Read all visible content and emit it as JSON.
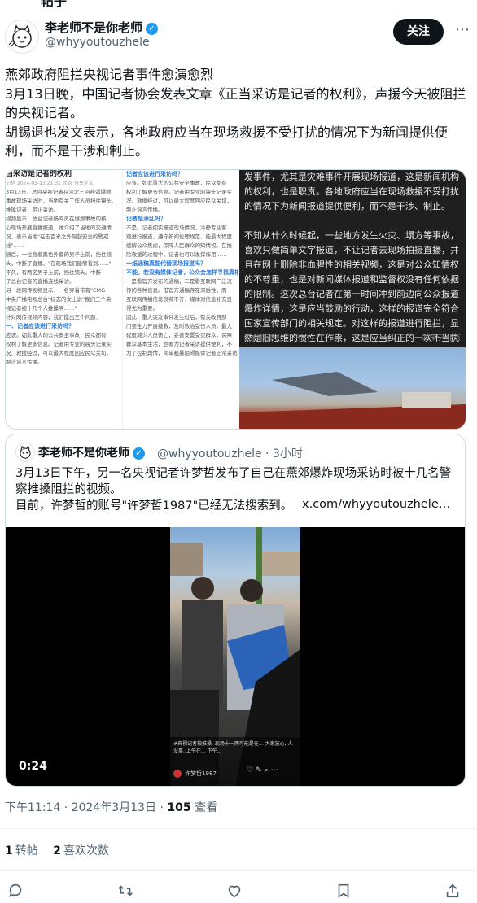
{
  "topcut_text": "帖子",
  "author": {
    "name": "李老师不是你老师",
    "handle": "@whyyoutouzhele"
  },
  "follow_label": "关注",
  "more_label": "⋯",
  "tweet": {
    "lines": [
      "燕郊政府阻拦央视记者事件愈演愈烈",
      "3月13日晚，中国记者协会发表文章《正当采访是记者的权利》，声援今天被阻拦的央视记者。",
      "胡锡退也发文表示，各地政府应当在现场救援不受打扰的情况下为新闻提供便利，而不是干涉和制止。"
    ]
  },
  "media": {
    "doc1": {
      "title": "当采访是记者的权利",
      "meta": "记协   2024-03-13 21:31   北京   分享全文",
      "paras": [
        "3月13日，总台央视记者在河北三河燕郊爆燃",
        "事故现场采访时，当地有关工作人员挡住镜头、",
        "推搡记者，阻止采访。",
        "视频显示，总台记者杨海灵在爆燃事故的核",
        "心现场开展直播报道，她介绍了当地的交通情",
        "况，表示当地\"在五百米之外架起安全的警戒",
        "线\"……",
        "随后，一位身着黑色外套的男子上前，挡住镜",
        "头，中断了直播。\"在现场我们能够看到……\"",
        "不久，有两名男子上前，挡住镜头，中断",
        "了总台记者的直播连线采访。",
        "另一段网传视频显示，一名穿着带有\"CMG",
        "中央广播电视总台\"标志的女士说\"我们三个央",
        "视记者被十几个人推搡啊……\"",
        "针对网传视频内容，我们提出三个问题：",
        "一、记者应该进行采访吗？",
        "应该。如此重大的公共安全事故，民众都有",
        "权利了解更多信息。记者用专业的镜头记录实",
        "况、救援经过，可以最大程度回应民众关切，",
        "制止谣言传播。"
      ]
    },
    "doc2": {
      "paras": [
        "记者应该进行采访吗？",
        "应该。如此重大的公共安全事故，民众都有",
        "权利了解更多信息。记者用专业的镜头记录实",
        "况、救援经过，可以最大程度回应民众关切，",
        "制止谣言传播。",
        "记者是添乱吗？",
        "不是。记者如实报道现场情况，冷静专业客",
        "观进行报道，遵守新闻伦理规范，能最大程度",
        "缓解公众焦虑，保障人民群众的知情权。在抢",
        "险救援的过程中，记者也可以发挥作用……",
        "一纸通稿真能代替现场报道吗？",
        "不能。若没有媒体记者，公众会怎样寻找真相？",
        "一是看官方发布的通稿，二是看互联网广泛流",
        "传的各种信息。但官方通稿存在滞后性，而",
        "互联网传播信息良莠不齐，媒体对信息补充显",
        "得尤为重要。",
        "因此，重大突发事件发生过后，有关政府部",
        "门要全力开展搜救，及时救治受伤人员，最大",
        "程度减少人员伤亡，妥善安置受灾群众，保障",
        "群众基本生活，也要为记者采访提供便利，不",
        "为了控制舆情，简单粗暴阻碍媒体记者正常采访。"
      ]
    },
    "doc3": {
      "text": "发事件，尤其是灾难事件开展现场报道，这是新闻机构的权利，也是职责。各地政府应当在现场救援不受打扰的情况下为新闻报道提供便利，而不是干涉、制止。\n\n不知从什么时候起，一些地方发生火灾、塌方等事故，喜欢只做简单文字报道，不让记者去现场拍摄直播，并且在网上删除非血腥性的相关视频，这是对公众知情权的不尊重，也是对新闻媒体报道和监督权没有任何依据的限制。这次总台记者在第一时间冲到前边向公众报道爆炸详情，这是应当鼓励的行动，这样的报道完全符合国家宣传部门的相关规定。对这样的报道进行阻拦，显然是旧思维的惯性在作祟，这是应当纠正的一次不当执法。",
      "translate": "查看翻译",
      "location": "发布于 北京"
    }
  },
  "quote": {
    "name": "李老师不是你老师",
    "handle": "@whyyoutouzhele · 3小时",
    "lines": [
      "3月13日下午，另一名央视记者许梦哲发布了自己在燕郊爆炸现场采访时被十几名警察推搡阻拦的视频。",
      "目前，许梦哲的账号\"许梦哲1987\"已经无法搜索到。"
    ],
    "link": "x.com/whyyoutouzhele…",
    "video_time": "0:24",
    "video_caption": "#央视记者被推搡, 现场十一两可能是在… 大家放心, 人没事. 上午在… 下午…",
    "video_user": "许梦哲1987"
  },
  "meta": {
    "time": "下午11:14 · 2024年3月13日 · ",
    "views_count": "105",
    "views_label": " 查看"
  },
  "stats": {
    "reposts_count": "1",
    "reposts_label": "转帖",
    "likes_count": "2",
    "likes_label": "喜欢次数"
  },
  "colors": {
    "accent": "#1d9bf0",
    "text": "#0f1419",
    "muted": "#536471",
    "border": "#cfd9de"
  }
}
